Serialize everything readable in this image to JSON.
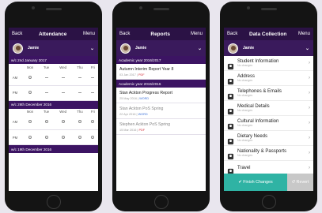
{
  "attendance": {
    "nav": {
      "back": "Back",
      "title": "Attendance",
      "menu": "Menu"
    },
    "user": "Jamie",
    "days": [
      "Mon",
      "Tue",
      "Wed",
      "Thu",
      "Fri"
    ],
    "sessions": [
      "AM",
      "PM"
    ],
    "weeks": [
      {
        "label": "w/c 2nd January 2017",
        "am": [
          "o",
          "-",
          "-",
          "-",
          "-"
        ],
        "pm": [
          "o",
          "-",
          "-",
          "-",
          "-"
        ]
      },
      {
        "label": "w/c 26th December 2016",
        "am": [
          "o",
          "o",
          "o",
          "o",
          "o"
        ],
        "pm": [
          "o",
          "o",
          "o",
          "o",
          "o"
        ]
      },
      {
        "label": "w/c 19th December 2016",
        "am": [],
        "pm": []
      }
    ]
  },
  "reports": {
    "nav": {
      "back": "Back",
      "title": "Reports",
      "menu": "Menu"
    },
    "user": "Jamie",
    "years": [
      {
        "label": "Academic year 2016/2017",
        "items": [
          {
            "title": "Autumn Interim Report Year 8",
            "date": "03 Jan 2017",
            "type": "PDF",
            "kind": "pdf",
            "dim": false
          }
        ]
      },
      {
        "label": "Academic year 2015/2016",
        "items": [
          {
            "title": "Stan Ackton Progress Report",
            "date": "25 May 2016",
            "type": "WORD",
            "kind": "word",
            "dim": false
          },
          {
            "title": "Stan Ackton PoS Spring",
            "date": "22 Apr 2016",
            "type": "WORD",
            "kind": "word",
            "dim": true
          },
          {
            "title": "Stephen Ackton PoS Spring",
            "date": "15 Mar 2016",
            "type": "PDF",
            "kind": "pdf",
            "dim": true
          }
        ]
      }
    ]
  },
  "datacollection": {
    "nav": {
      "back": "Back",
      "title": "Data Collection",
      "menu": "Menu"
    },
    "user": "Jamie",
    "items": [
      {
        "title": "Student Information",
        "status": "No changes",
        "icon": "user-icon"
      },
      {
        "title": "Address",
        "status": "No changes",
        "icon": "home-icon"
      },
      {
        "title": "Telephones & Emails",
        "status": "No changes",
        "icon": "phone-icon"
      },
      {
        "title": "Medical Details",
        "status": "No changes",
        "icon": "medical-kit-icon"
      },
      {
        "title": "Cultural Information",
        "status": "No changes",
        "icon": "globe-icon"
      },
      {
        "title": "Dietary Needs",
        "status": "No changes",
        "icon": "cutlery-icon"
      },
      {
        "title": "Nationality & Passports",
        "status": "No changes",
        "icon": "passport-icon"
      },
      {
        "title": "Travel",
        "status": "",
        "icon": "bus-icon"
      }
    ],
    "finish_label": "✔ Finish Changes",
    "revert_label": "↺ Revert"
  },
  "colors": {
    "nav": "#2b1245",
    "section": "#3c1463",
    "finish": "#2fb3a4",
    "revert": "#c8c8c8"
  }
}
